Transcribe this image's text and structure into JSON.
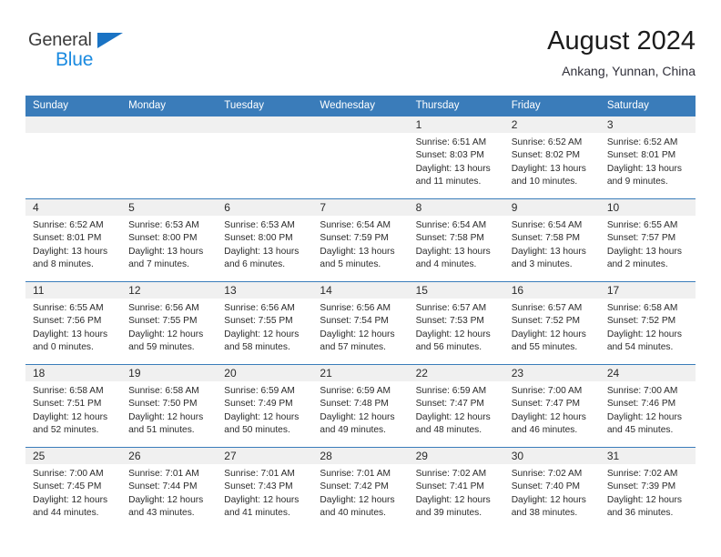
{
  "brand": {
    "line1": "General",
    "line2": "Blue",
    "triangle_color": "#1a73c4",
    "blue_text_color": "#1a8ae0"
  },
  "header": {
    "title": "August 2024",
    "location": "Ankang, Yunnan, China"
  },
  "theme": {
    "header_blue": "#3a7cba",
    "day_band_gray": "#f0f0f0",
    "text": "#2a2a2a"
  },
  "weekdays": [
    "Sunday",
    "Monday",
    "Tuesday",
    "Wednesday",
    "Thursday",
    "Friday",
    "Saturday"
  ],
  "weeks": [
    [
      {
        "day": "",
        "sunrise": "",
        "sunset": "",
        "daylight1": "",
        "daylight2": "",
        "empty": true
      },
      {
        "day": "",
        "sunrise": "",
        "sunset": "",
        "daylight1": "",
        "daylight2": "",
        "empty": true
      },
      {
        "day": "",
        "sunrise": "",
        "sunset": "",
        "daylight1": "",
        "daylight2": "",
        "empty": true
      },
      {
        "day": "",
        "sunrise": "",
        "sunset": "",
        "daylight1": "",
        "daylight2": "",
        "empty": true
      },
      {
        "day": "1",
        "sunrise": "Sunrise: 6:51 AM",
        "sunset": "Sunset: 8:03 PM",
        "daylight1": "Daylight: 13 hours",
        "daylight2": "and 11 minutes."
      },
      {
        "day": "2",
        "sunrise": "Sunrise: 6:52 AM",
        "sunset": "Sunset: 8:02 PM",
        "daylight1": "Daylight: 13 hours",
        "daylight2": "and 10 minutes."
      },
      {
        "day": "3",
        "sunrise": "Sunrise: 6:52 AM",
        "sunset": "Sunset: 8:01 PM",
        "daylight1": "Daylight: 13 hours",
        "daylight2": "and 9 minutes."
      }
    ],
    [
      {
        "day": "4",
        "sunrise": "Sunrise: 6:52 AM",
        "sunset": "Sunset: 8:01 PM",
        "daylight1": "Daylight: 13 hours",
        "daylight2": "and 8 minutes."
      },
      {
        "day": "5",
        "sunrise": "Sunrise: 6:53 AM",
        "sunset": "Sunset: 8:00 PM",
        "daylight1": "Daylight: 13 hours",
        "daylight2": "and 7 minutes."
      },
      {
        "day": "6",
        "sunrise": "Sunrise: 6:53 AM",
        "sunset": "Sunset: 8:00 PM",
        "daylight1": "Daylight: 13 hours",
        "daylight2": "and 6 minutes."
      },
      {
        "day": "7",
        "sunrise": "Sunrise: 6:54 AM",
        "sunset": "Sunset: 7:59 PM",
        "daylight1": "Daylight: 13 hours",
        "daylight2": "and 5 minutes."
      },
      {
        "day": "8",
        "sunrise": "Sunrise: 6:54 AM",
        "sunset": "Sunset: 7:58 PM",
        "daylight1": "Daylight: 13 hours",
        "daylight2": "and 4 minutes."
      },
      {
        "day": "9",
        "sunrise": "Sunrise: 6:54 AM",
        "sunset": "Sunset: 7:58 PM",
        "daylight1": "Daylight: 13 hours",
        "daylight2": "and 3 minutes."
      },
      {
        "day": "10",
        "sunrise": "Sunrise: 6:55 AM",
        "sunset": "Sunset: 7:57 PM",
        "daylight1": "Daylight: 13 hours",
        "daylight2": "and 2 minutes."
      }
    ],
    [
      {
        "day": "11",
        "sunrise": "Sunrise: 6:55 AM",
        "sunset": "Sunset: 7:56 PM",
        "daylight1": "Daylight: 13 hours",
        "daylight2": "and 0 minutes."
      },
      {
        "day": "12",
        "sunrise": "Sunrise: 6:56 AM",
        "sunset": "Sunset: 7:55 PM",
        "daylight1": "Daylight: 12 hours",
        "daylight2": "and 59 minutes."
      },
      {
        "day": "13",
        "sunrise": "Sunrise: 6:56 AM",
        "sunset": "Sunset: 7:55 PM",
        "daylight1": "Daylight: 12 hours",
        "daylight2": "and 58 minutes."
      },
      {
        "day": "14",
        "sunrise": "Sunrise: 6:56 AM",
        "sunset": "Sunset: 7:54 PM",
        "daylight1": "Daylight: 12 hours",
        "daylight2": "and 57 minutes."
      },
      {
        "day": "15",
        "sunrise": "Sunrise: 6:57 AM",
        "sunset": "Sunset: 7:53 PM",
        "daylight1": "Daylight: 12 hours",
        "daylight2": "and 56 minutes."
      },
      {
        "day": "16",
        "sunrise": "Sunrise: 6:57 AM",
        "sunset": "Sunset: 7:52 PM",
        "daylight1": "Daylight: 12 hours",
        "daylight2": "and 55 minutes."
      },
      {
        "day": "17",
        "sunrise": "Sunrise: 6:58 AM",
        "sunset": "Sunset: 7:52 PM",
        "daylight1": "Daylight: 12 hours",
        "daylight2": "and 54 minutes."
      }
    ],
    [
      {
        "day": "18",
        "sunrise": "Sunrise: 6:58 AM",
        "sunset": "Sunset: 7:51 PM",
        "daylight1": "Daylight: 12 hours",
        "daylight2": "and 52 minutes."
      },
      {
        "day": "19",
        "sunrise": "Sunrise: 6:58 AM",
        "sunset": "Sunset: 7:50 PM",
        "daylight1": "Daylight: 12 hours",
        "daylight2": "and 51 minutes."
      },
      {
        "day": "20",
        "sunrise": "Sunrise: 6:59 AM",
        "sunset": "Sunset: 7:49 PM",
        "daylight1": "Daylight: 12 hours",
        "daylight2": "and 50 minutes."
      },
      {
        "day": "21",
        "sunrise": "Sunrise: 6:59 AM",
        "sunset": "Sunset: 7:48 PM",
        "daylight1": "Daylight: 12 hours",
        "daylight2": "and 49 minutes."
      },
      {
        "day": "22",
        "sunrise": "Sunrise: 6:59 AM",
        "sunset": "Sunset: 7:47 PM",
        "daylight1": "Daylight: 12 hours",
        "daylight2": "and 48 minutes."
      },
      {
        "day": "23",
        "sunrise": "Sunrise: 7:00 AM",
        "sunset": "Sunset: 7:47 PM",
        "daylight1": "Daylight: 12 hours",
        "daylight2": "and 46 minutes."
      },
      {
        "day": "24",
        "sunrise": "Sunrise: 7:00 AM",
        "sunset": "Sunset: 7:46 PM",
        "daylight1": "Daylight: 12 hours",
        "daylight2": "and 45 minutes."
      }
    ],
    [
      {
        "day": "25",
        "sunrise": "Sunrise: 7:00 AM",
        "sunset": "Sunset: 7:45 PM",
        "daylight1": "Daylight: 12 hours",
        "daylight2": "and 44 minutes."
      },
      {
        "day": "26",
        "sunrise": "Sunrise: 7:01 AM",
        "sunset": "Sunset: 7:44 PM",
        "daylight1": "Daylight: 12 hours",
        "daylight2": "and 43 minutes."
      },
      {
        "day": "27",
        "sunrise": "Sunrise: 7:01 AM",
        "sunset": "Sunset: 7:43 PM",
        "daylight1": "Daylight: 12 hours",
        "daylight2": "and 41 minutes."
      },
      {
        "day": "28",
        "sunrise": "Sunrise: 7:01 AM",
        "sunset": "Sunset: 7:42 PM",
        "daylight1": "Daylight: 12 hours",
        "daylight2": "and 40 minutes."
      },
      {
        "day": "29",
        "sunrise": "Sunrise: 7:02 AM",
        "sunset": "Sunset: 7:41 PM",
        "daylight1": "Daylight: 12 hours",
        "daylight2": "and 39 minutes."
      },
      {
        "day": "30",
        "sunrise": "Sunrise: 7:02 AM",
        "sunset": "Sunset: 7:40 PM",
        "daylight1": "Daylight: 12 hours",
        "daylight2": "and 38 minutes."
      },
      {
        "day": "31",
        "sunrise": "Sunrise: 7:02 AM",
        "sunset": "Sunset: 7:39 PM",
        "daylight1": "Daylight: 12 hours",
        "daylight2": "and 36 minutes."
      }
    ]
  ]
}
